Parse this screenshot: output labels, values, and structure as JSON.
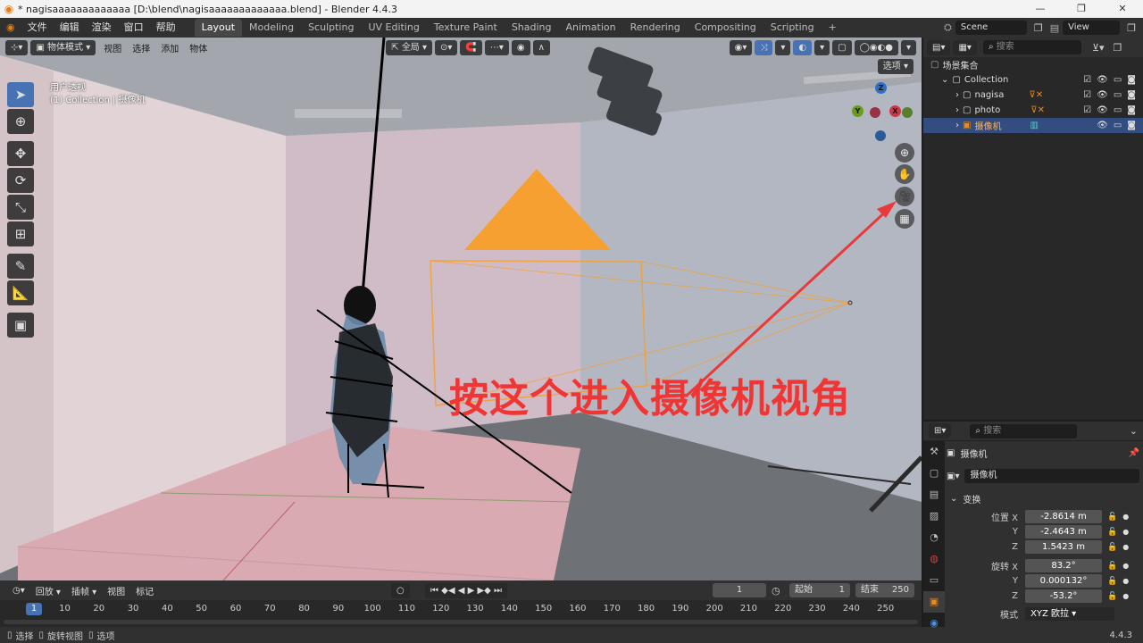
{
  "window": {
    "title": "* nagisaaaaaaaaaaaaa [D:\\blend\\nagisaaaaaaaaaaaaa.blend] - Blender 4.4.3",
    "controls": [
      "—",
      "❐",
      "✕"
    ]
  },
  "topbar": {
    "menus": [
      "文件",
      "编辑",
      "渲染",
      "窗口",
      "帮助"
    ],
    "workspaces": [
      "Layout",
      "Modeling",
      "Sculpting",
      "UV Editing",
      "Texture Paint",
      "Shading",
      "Animation",
      "Rendering",
      "Compositing",
      "Scripting"
    ],
    "active_workspace": "Layout",
    "add_tab": "+",
    "scene": "Scene",
    "view_layer": "View Layer"
  },
  "viewport": {
    "mode": "物体模式",
    "menus": [
      "视图",
      "选择",
      "添加",
      "物体"
    ],
    "transform_orientation": "全局",
    "view_name": "用户透视",
    "collection_info": "(1) Collection | 摄像机",
    "options_label": "选项",
    "gizmo_axes": [
      "Z",
      "Y",
      "X"
    ],
    "annotation_text": "按这个进入摄像机视角",
    "colors": {
      "annotation": "#f03535",
      "camera_marker": "#f5a030",
      "x_axis": "#c9384d",
      "y_axis": "#6a9b1b",
      "z_axis": "#2f6fbf"
    }
  },
  "timeline": {
    "menus": [
      "回放",
      "插帧",
      "视图",
      "标记"
    ],
    "current_frame": "1",
    "start_label": "起始",
    "start_value": "1",
    "end_label": "结束",
    "end_value": "250",
    "ticks": [
      "1",
      "10",
      "20",
      "30",
      "40",
      "50",
      "60",
      "70",
      "80",
      "90",
      "100",
      "110",
      "120",
      "130",
      "140",
      "150",
      "160",
      "170",
      "180",
      "190",
      "200",
      "210",
      "220",
      "230",
      "240",
      "250"
    ]
  },
  "statusbar": {
    "items": [
      "选择",
      "旋转视图",
      "选项"
    ],
    "version": "4.4.3"
  },
  "outliner": {
    "search_placeholder": "搜索",
    "scene_collection": "场景集合",
    "rows": [
      {
        "name": "Collection",
        "indent": 1
      },
      {
        "name": "nagisa",
        "indent": 2
      },
      {
        "name": "photo",
        "indent": 2
      },
      {
        "name": "摄像机",
        "indent": 2,
        "selected": true
      }
    ]
  },
  "properties": {
    "search_placeholder": "搜索",
    "object_name": "摄像机",
    "data_name": "摄像机",
    "section": "变换",
    "location_label": "位置 X",
    "location": {
      "x": "-2.8614 m",
      "y": "-2.4643 m",
      "z": "1.5423 m"
    },
    "rotation_label": "旋转 X",
    "rotation": {
      "x": "83.2°",
      "y": "0.000132°",
      "z": "-53.2°"
    },
    "axis_y": "Y",
    "axis_z": "Z",
    "mode_label": "模式",
    "mode_value": "XYZ 欧拉"
  }
}
